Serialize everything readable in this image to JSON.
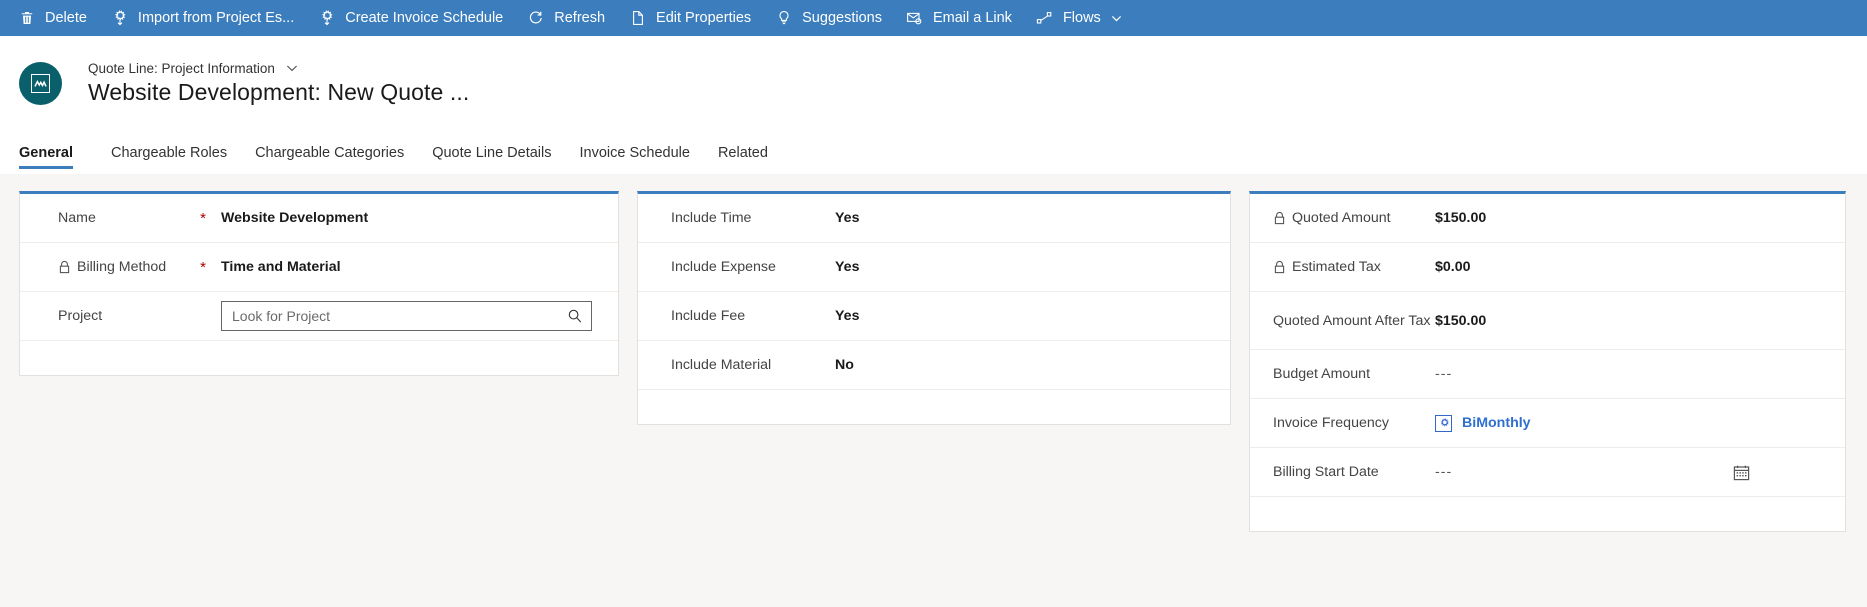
{
  "commandbar": {
    "items": [
      {
        "label": "Delete",
        "icon": "trash-icon"
      },
      {
        "label": "Import from Project Es...",
        "icon": "import-icon"
      },
      {
        "label": "Create Invoice Schedule",
        "icon": "create-schedule-icon"
      },
      {
        "label": "Refresh",
        "icon": "refresh-icon"
      },
      {
        "label": "Edit Properties",
        "icon": "edit-properties-icon"
      },
      {
        "label": "Suggestions",
        "icon": "lightbulb-icon"
      },
      {
        "label": "Email a Link",
        "icon": "email-link-icon"
      },
      {
        "label": "Flows",
        "icon": "flows-icon",
        "chevron": true
      }
    ]
  },
  "header": {
    "entity_label": "Quote Line: Project Information",
    "record_title": "Website Development: New Quote ..."
  },
  "tabs": [
    {
      "label": "General",
      "active": true
    },
    {
      "label": "Chargeable Roles",
      "active": false
    },
    {
      "label": "Chargeable Categories",
      "active": false
    },
    {
      "label": "Quote Line Details",
      "active": false
    },
    {
      "label": "Invoice Schedule",
      "active": false
    },
    {
      "label": "Related",
      "active": false
    }
  ],
  "cards": {
    "left": {
      "rows": [
        {
          "label": "Name",
          "required": true,
          "locked": false,
          "value": "Website Development",
          "type": "text"
        },
        {
          "label": "Billing Method",
          "required": true,
          "locked": true,
          "value": "Time and Material",
          "type": "text"
        },
        {
          "label": "Project",
          "required": false,
          "locked": false,
          "placeholder": "Look for Project",
          "type": "lookup"
        }
      ]
    },
    "middle": {
      "rows": [
        {
          "label": "Include Time",
          "value": "Yes"
        },
        {
          "label": "Include Expense",
          "value": "Yes"
        },
        {
          "label": "Include Fee",
          "value": "Yes"
        },
        {
          "label": "Include Material",
          "value": "No"
        }
      ]
    },
    "right": {
      "rows": [
        {
          "label": "Quoted Amount",
          "locked": true,
          "value": "$150.00",
          "type": "text"
        },
        {
          "label": "Estimated Tax",
          "locked": true,
          "value": "$0.00",
          "type": "text"
        },
        {
          "label": "Quoted Amount After Tax",
          "locked": false,
          "value": "$150.00",
          "type": "text"
        },
        {
          "label": "Budget Amount",
          "locked": false,
          "value": "---",
          "type": "empty"
        },
        {
          "label": "Invoice Frequency",
          "locked": false,
          "value": "BiMonthly",
          "type": "link"
        },
        {
          "label": "Billing Start Date",
          "locked": false,
          "value": "---",
          "type": "date"
        }
      ]
    }
  },
  "colors": {
    "command_bar": "#3b7dbd",
    "accent": "#3b7dbd",
    "avatar": "#09606b",
    "required_asterisk": "#a80000",
    "link": "#2f6fd0",
    "canvas": "#f7f6f5"
  }
}
